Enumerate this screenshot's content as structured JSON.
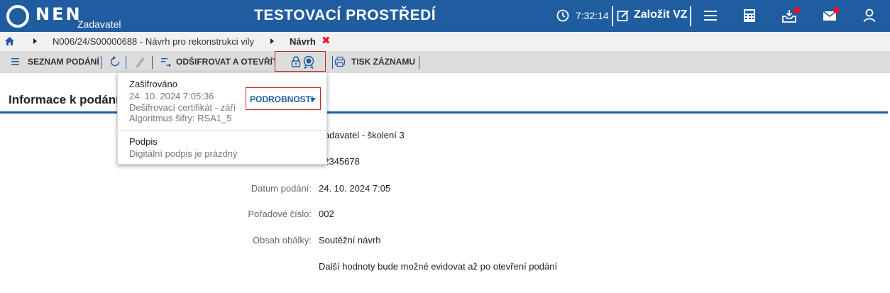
{
  "header": {
    "logo_text": "NEN",
    "logo_sub": "Zadavatel",
    "environment_title": "TESTOVACÍ PROSTŘEDÍ",
    "clock": "7:32:14",
    "create_label": "Založit VZ",
    "icons": [
      "clock-icon",
      "edit-icon",
      "menu-icon",
      "calculator-icon",
      "inbox-icon",
      "mail-icon",
      "user-icon"
    ],
    "notification_color": "#e8112d",
    "brand_color": "#1f5da0"
  },
  "breadcrumb": {
    "items": [
      "N006/24/S00000688 - Návrh pro rekonstrukci vily",
      "Návrh"
    ],
    "close_symbol": "✖"
  },
  "toolbar": {
    "list_label": "SEZNAM PODÁNÍ",
    "decrypt_label": "ODŠIFROVAT A OTEVŘÍT",
    "print_label": "TISK ZÁZNAMU"
  },
  "panel": {
    "title": "Informace k podání",
    "fields": [
      {
        "label": "",
        "value": "Zadavatel - školení 3"
      },
      {
        "label": "",
        "value": "12345678"
      },
      {
        "label": "Datum podání:",
        "value": "24. 10. 2024 7:05"
      },
      {
        "label": "Pořadové číslo:",
        "value": "002"
      },
      {
        "label": "Obsah obálky:",
        "value": "Soutěžní návrh"
      },
      {
        "label": "",
        "value": "Další hodnoty bude možné evidovat až po otevření podání"
      }
    ]
  },
  "popup": {
    "encryption_title": "Zašifrováno",
    "encryption_date": "24. 10. 2024 7:05:36",
    "encryption_cert": "Dešifrovací certifikát - září",
    "encryption_algo": "Algoritmus šifry: RSA1_5",
    "details_button": "PODROBNOSTI",
    "signature_title": "Podpis",
    "signature_status": "Digitální podpis je prázdný"
  }
}
